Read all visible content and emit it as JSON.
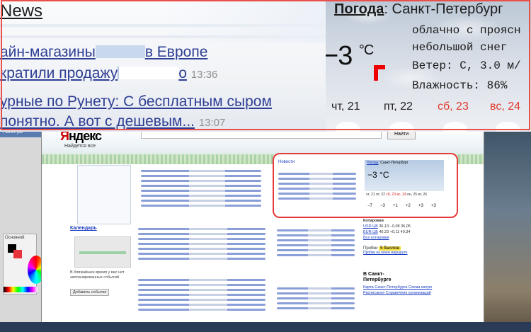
{
  "colors": {
    "accent_red": "#e9504a",
    "link_blue": "#2d3e94",
    "weekend_red": "#e03b2f"
  },
  "zoom": {
    "news": {
      "title": "News",
      "line1a": "айн-магазины",
      "line1b": "в Европе",
      "line2a": "кратили продажу",
      "line2b": "о",
      "line2_time": "13:36",
      "line3": "урные по Рунету: С бесплатным сыром",
      "line4": "понятно. А вот с дешевым...",
      "line4_time": "13:07"
    },
    "weather": {
      "title_label": "Погода",
      "title_city": ": Санкт-Петербург",
      "temp": "−3",
      "unit": "°C",
      "desc1": "облачно с проясн",
      "desc2": "небольшой снег",
      "wind": "Ветер: С, 3.0 м/",
      "humidity": "Влажность: 86%",
      "days": [
        {
          "label": "чт, 21",
          "weekend": false
        },
        {
          "label": "пт, 22",
          "weekend": false
        },
        {
          "label": "сб, 23",
          "weekend": true
        },
        {
          "label": "вс, 24",
          "weekend": true
        }
      ]
    }
  },
  "browser": {
    "logo_red": "Я",
    "logo_black": "ндекс",
    "tagline": "Найдется все",
    "search_button": "Найти",
    "calendar_title": "Календарь",
    "calendar_note": "В ближайшее время у вас нет запланированных событий",
    "calendar_add": "Добавить событие",
    "news_head": "Новости",
    "mini_weather_title": "Погода",
    "mini_weather_city": ": Санкт-Петербург",
    "mini_temp": "−3 °C",
    "mini_days": [
      "чт, 21",
      "пт, 22",
      "сб, 23",
      "вс, 24",
      "пн, 25",
      "вт, 26"
    ],
    "mini_temps": [
      "−7",
      "−3",
      "+1",
      "+2",
      "+3",
      "+3"
    ],
    "rates_title": "Котировки",
    "rate_usd_label": "USD ЦБ",
    "rate_usd": "36,13 −0,08 36,05",
    "rate_eur_label": "EUR ЦБ",
    "rate_eur": "40,23 +0,11 40,34",
    "rates_link": "Все котировки",
    "probki_label": "Пробки",
    "probki_score": "5 баллов",
    "probki_link": "Пробки на моем маршруте",
    "city_heading": "В Санкт-Петербурге",
    "city_link1": "Карта Санкт-Петербурга",
    "city_link2": "Схема метро",
    "city_link3": "Расписания",
    "city_link4": "Справочник организаций"
  },
  "side": {
    "panel_title": "Палитра",
    "panel_label": "Основной"
  }
}
